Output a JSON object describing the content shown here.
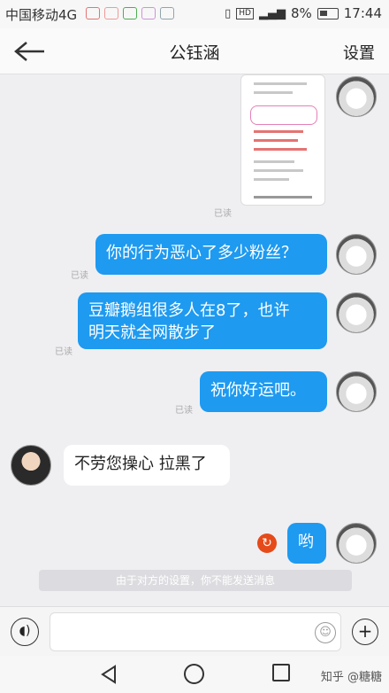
{
  "status_bar": {
    "carrier": "中国移动4G",
    "network": "4G",
    "hd": "HD",
    "battery": "8%",
    "time": "17:44"
  },
  "header": {
    "title": "公钰涵",
    "settings_label": "设置"
  },
  "messages": [
    {
      "text": "你的行为恶心了多少粉丝？",
      "read": "已读"
    },
    {
      "text": "豆瓣鹅组很多人在8了，也许\n明天就全网散步了",
      "read": "已读"
    },
    {
      "text": "祝你好运吧。",
      "read": "已读"
    },
    {
      "text": "不劳您操心 拉黑了"
    },
    {
      "text": "哟"
    }
  ],
  "image_message_read": "已读",
  "system_notice": "由于对方的设置，你不能发送消息",
  "watermark": "知乎 @糖糖"
}
